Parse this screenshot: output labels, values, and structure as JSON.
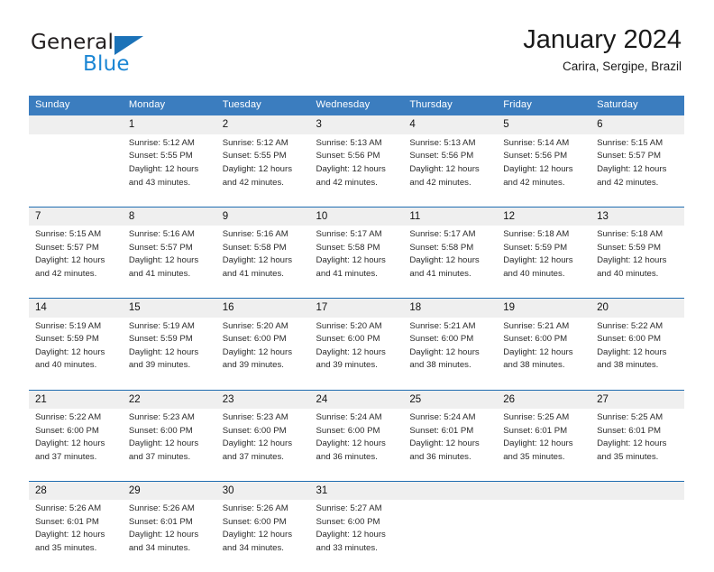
{
  "brand": {
    "name_top": "General",
    "name_bottom": "Blue",
    "triangle_icon": "brand-triangle-icon",
    "color_dark": "#231f20",
    "color_blue": "#1b86d4",
    "color_triangle": "#1b72b8"
  },
  "header": {
    "title": "January 2024",
    "subtitle": "Carira, Sergipe, Brazil"
  },
  "theme": {
    "header_bg": "#3b7dbf",
    "header_text": "#ffffff",
    "daynum_bg": "#efefef",
    "row_divider": "#1f6cb0",
    "body_text": "#2b2b2b"
  },
  "weekdays": [
    "Sunday",
    "Monday",
    "Tuesday",
    "Wednesday",
    "Thursday",
    "Friday",
    "Saturday"
  ],
  "weeks": [
    [
      {
        "day": "",
        "sunrise": "",
        "sunset": "",
        "daylight1": "",
        "daylight2": ""
      },
      {
        "day": "1",
        "sunrise": "Sunrise: 5:12 AM",
        "sunset": "Sunset: 5:55 PM",
        "daylight1": "Daylight: 12 hours",
        "daylight2": "and 43 minutes."
      },
      {
        "day": "2",
        "sunrise": "Sunrise: 5:12 AM",
        "sunset": "Sunset: 5:55 PM",
        "daylight1": "Daylight: 12 hours",
        "daylight2": "and 42 minutes."
      },
      {
        "day": "3",
        "sunrise": "Sunrise: 5:13 AM",
        "sunset": "Sunset: 5:56 PM",
        "daylight1": "Daylight: 12 hours",
        "daylight2": "and 42 minutes."
      },
      {
        "day": "4",
        "sunrise": "Sunrise: 5:13 AM",
        "sunset": "Sunset: 5:56 PM",
        "daylight1": "Daylight: 12 hours",
        "daylight2": "and 42 minutes."
      },
      {
        "day": "5",
        "sunrise": "Sunrise: 5:14 AM",
        "sunset": "Sunset: 5:56 PM",
        "daylight1": "Daylight: 12 hours",
        "daylight2": "and 42 minutes."
      },
      {
        "day": "6",
        "sunrise": "Sunrise: 5:15 AM",
        "sunset": "Sunset: 5:57 PM",
        "daylight1": "Daylight: 12 hours",
        "daylight2": "and 42 minutes."
      }
    ],
    [
      {
        "day": "7",
        "sunrise": "Sunrise: 5:15 AM",
        "sunset": "Sunset: 5:57 PM",
        "daylight1": "Daylight: 12 hours",
        "daylight2": "and 42 minutes."
      },
      {
        "day": "8",
        "sunrise": "Sunrise: 5:16 AM",
        "sunset": "Sunset: 5:57 PM",
        "daylight1": "Daylight: 12 hours",
        "daylight2": "and 41 minutes."
      },
      {
        "day": "9",
        "sunrise": "Sunrise: 5:16 AM",
        "sunset": "Sunset: 5:58 PM",
        "daylight1": "Daylight: 12 hours",
        "daylight2": "and 41 minutes."
      },
      {
        "day": "10",
        "sunrise": "Sunrise: 5:17 AM",
        "sunset": "Sunset: 5:58 PM",
        "daylight1": "Daylight: 12 hours",
        "daylight2": "and 41 minutes."
      },
      {
        "day": "11",
        "sunrise": "Sunrise: 5:17 AM",
        "sunset": "Sunset: 5:58 PM",
        "daylight1": "Daylight: 12 hours",
        "daylight2": "and 41 minutes."
      },
      {
        "day": "12",
        "sunrise": "Sunrise: 5:18 AM",
        "sunset": "Sunset: 5:59 PM",
        "daylight1": "Daylight: 12 hours",
        "daylight2": "and 40 minutes."
      },
      {
        "day": "13",
        "sunrise": "Sunrise: 5:18 AM",
        "sunset": "Sunset: 5:59 PM",
        "daylight1": "Daylight: 12 hours",
        "daylight2": "and 40 minutes."
      }
    ],
    [
      {
        "day": "14",
        "sunrise": "Sunrise: 5:19 AM",
        "sunset": "Sunset: 5:59 PM",
        "daylight1": "Daylight: 12 hours",
        "daylight2": "and 40 minutes."
      },
      {
        "day": "15",
        "sunrise": "Sunrise: 5:19 AM",
        "sunset": "Sunset: 5:59 PM",
        "daylight1": "Daylight: 12 hours",
        "daylight2": "and 39 minutes."
      },
      {
        "day": "16",
        "sunrise": "Sunrise: 5:20 AM",
        "sunset": "Sunset: 6:00 PM",
        "daylight1": "Daylight: 12 hours",
        "daylight2": "and 39 minutes."
      },
      {
        "day": "17",
        "sunrise": "Sunrise: 5:20 AM",
        "sunset": "Sunset: 6:00 PM",
        "daylight1": "Daylight: 12 hours",
        "daylight2": "and 39 minutes."
      },
      {
        "day": "18",
        "sunrise": "Sunrise: 5:21 AM",
        "sunset": "Sunset: 6:00 PM",
        "daylight1": "Daylight: 12 hours",
        "daylight2": "and 38 minutes."
      },
      {
        "day": "19",
        "sunrise": "Sunrise: 5:21 AM",
        "sunset": "Sunset: 6:00 PM",
        "daylight1": "Daylight: 12 hours",
        "daylight2": "and 38 minutes."
      },
      {
        "day": "20",
        "sunrise": "Sunrise: 5:22 AM",
        "sunset": "Sunset: 6:00 PM",
        "daylight1": "Daylight: 12 hours",
        "daylight2": "and 38 minutes."
      }
    ],
    [
      {
        "day": "21",
        "sunrise": "Sunrise: 5:22 AM",
        "sunset": "Sunset: 6:00 PM",
        "daylight1": "Daylight: 12 hours",
        "daylight2": "and 37 minutes."
      },
      {
        "day": "22",
        "sunrise": "Sunrise: 5:23 AM",
        "sunset": "Sunset: 6:00 PM",
        "daylight1": "Daylight: 12 hours",
        "daylight2": "and 37 minutes."
      },
      {
        "day": "23",
        "sunrise": "Sunrise: 5:23 AM",
        "sunset": "Sunset: 6:00 PM",
        "daylight1": "Daylight: 12 hours",
        "daylight2": "and 37 minutes."
      },
      {
        "day": "24",
        "sunrise": "Sunrise: 5:24 AM",
        "sunset": "Sunset: 6:00 PM",
        "daylight1": "Daylight: 12 hours",
        "daylight2": "and 36 minutes."
      },
      {
        "day": "25",
        "sunrise": "Sunrise: 5:24 AM",
        "sunset": "Sunset: 6:01 PM",
        "daylight1": "Daylight: 12 hours",
        "daylight2": "and 36 minutes."
      },
      {
        "day": "26",
        "sunrise": "Sunrise: 5:25 AM",
        "sunset": "Sunset: 6:01 PM",
        "daylight1": "Daylight: 12 hours",
        "daylight2": "and 35 minutes."
      },
      {
        "day": "27",
        "sunrise": "Sunrise: 5:25 AM",
        "sunset": "Sunset: 6:01 PM",
        "daylight1": "Daylight: 12 hours",
        "daylight2": "and 35 minutes."
      }
    ],
    [
      {
        "day": "28",
        "sunrise": "Sunrise: 5:26 AM",
        "sunset": "Sunset: 6:01 PM",
        "daylight1": "Daylight: 12 hours",
        "daylight2": "and 35 minutes."
      },
      {
        "day": "29",
        "sunrise": "Sunrise: 5:26 AM",
        "sunset": "Sunset: 6:01 PM",
        "daylight1": "Daylight: 12 hours",
        "daylight2": "and 34 minutes."
      },
      {
        "day": "30",
        "sunrise": "Sunrise: 5:26 AM",
        "sunset": "Sunset: 6:00 PM",
        "daylight1": "Daylight: 12 hours",
        "daylight2": "and 34 minutes."
      },
      {
        "day": "31",
        "sunrise": "Sunrise: 5:27 AM",
        "sunset": "Sunset: 6:00 PM",
        "daylight1": "Daylight: 12 hours",
        "daylight2": "and 33 minutes."
      },
      {
        "day": "",
        "sunrise": "",
        "sunset": "",
        "daylight1": "",
        "daylight2": ""
      },
      {
        "day": "",
        "sunrise": "",
        "sunset": "",
        "daylight1": "",
        "daylight2": ""
      },
      {
        "day": "",
        "sunrise": "",
        "sunset": "",
        "daylight1": "",
        "daylight2": ""
      }
    ]
  ]
}
